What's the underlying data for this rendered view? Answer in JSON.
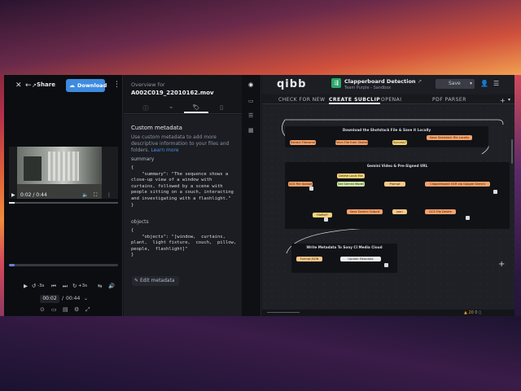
{
  "preview": {
    "share_label": "Share",
    "download_label": "Download",
    "video_time": "0:02 / 0:44",
    "skip_back": "-3s",
    "skip_fwd": "+3s",
    "timecode_current": "00:02",
    "timecode_sep": "/",
    "timecode_total": "00:44"
  },
  "overview": {
    "label": "Overview for",
    "filename": "A002C019_22010162.mov",
    "tabs": [
      "info-icon",
      "activity-icon",
      "tag-icon",
      "document-icon"
    ],
    "custom_metadata": {
      "title": "Custom metadata",
      "description": "Use custom metadata to add more descriptive information to your files and folders.",
      "learn_more": "Learn more",
      "summary_key": "summary",
      "summary_code": "{\n    \"summary\": \"The sequence shows a\nclose-up view of a window with\ncurtains, followed by a scene with\npeople sitting on a couch, interacting\nand investigating with a flashlight.\"\n}",
      "objects_key": "objects",
      "objects_code": "{\n    \"objects\": \"[window,  curtains,\nplant,  light fixture,  couch,  pillow,\npeople,  flashlight]\"\n}",
      "edit_label": "Edit metadata"
    }
  },
  "editor": {
    "logo": "qibb",
    "flow_name": "Clapperboard Detection",
    "flow_team": "Team Purple - Sandbox",
    "save_label": "Save",
    "tabs": [
      "CHECK FOR NEW",
      "CREATE SUBCLIP",
      "OPENAI",
      "PDF PARSER"
    ],
    "active_tab": "CREATE SUBCLIP",
    "groups": {
      "g1": "Download the Shotstack File & Save it Locally",
      "g2": "Gemini Video & Pre-Signed URL",
      "g3": "Write Metadata To Sony CI Media Cloud"
    },
    "nodes": {
      "extract": "Extract Filename",
      "fetch": "Fetch File from Shotstack",
      "success": "Success?",
      "save_local": "Save Shotstack File Locally",
      "delete_local": "Delete Local File",
      "gcs_upload": "GCS File Upload",
      "gemini_model": "Set Gemini Model",
      "prompt": "Prompt",
      "gemini_api": "Clapperboard OCR via Google Gemini",
      "file_ref": "FileRef?",
      "save_output": "Save Gemini Output",
      "json": "json",
      "gcs_delete": "GCS File Delete",
      "format_json": "Format JSON",
      "update_metadata": "Update Metadata"
    },
    "status": {
      "warning": "20",
      "count": "0"
    }
  }
}
